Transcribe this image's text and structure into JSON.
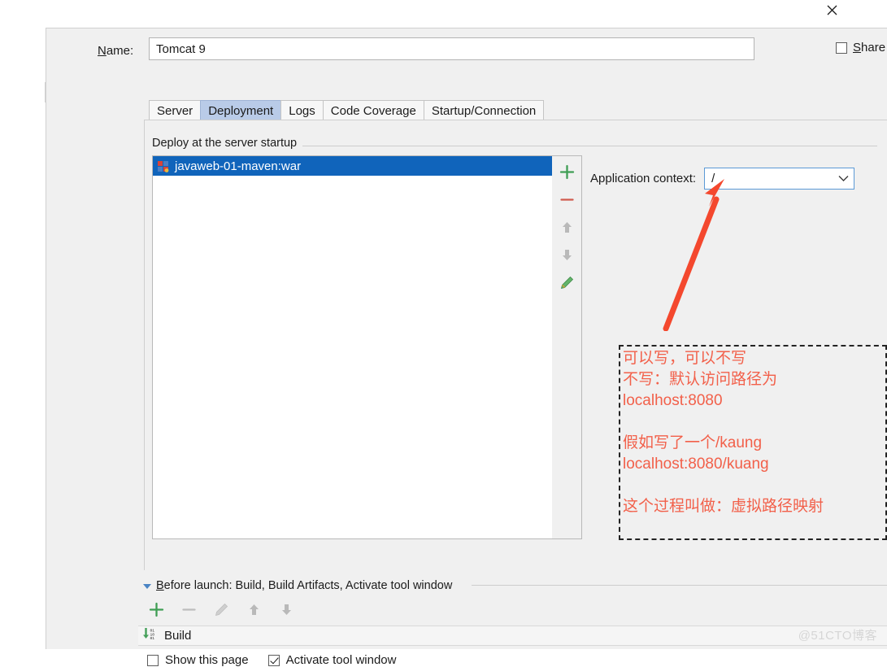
{
  "window": {
    "close_icon": "close-icon"
  },
  "name_row": {
    "label_accel": "N",
    "label_rest": "ame:",
    "value": "Tomcat 9",
    "placeholder": "Name",
    "share_label_accel": "S",
    "share_label_rest": "hare",
    "share_checked": false
  },
  "tabs": [
    {
      "label": "Server",
      "active": false
    },
    {
      "label": "Deployment",
      "active": true
    },
    {
      "label": "Logs",
      "active": false
    },
    {
      "label": "Code Coverage",
      "active": false
    },
    {
      "label": "Startup/Connection",
      "active": false
    }
  ],
  "deployment": {
    "group_title": "Deploy at the server startup",
    "items": [
      {
        "label": "javaweb-01-maven:war",
        "selected": true,
        "icon": "artifact-war-icon"
      }
    ],
    "toolbar": [
      {
        "name": "add-button",
        "icon": "plus-icon",
        "enabled": true
      },
      {
        "name": "remove-button",
        "icon": "minus-icon",
        "enabled": true
      },
      {
        "name": "move-up-button",
        "icon": "arrow-up-icon",
        "enabled": false
      },
      {
        "name": "move-down-button",
        "icon": "arrow-down-icon",
        "enabled": false
      },
      {
        "name": "edit-button",
        "icon": "pencil-icon",
        "enabled": true
      }
    ],
    "application_context": {
      "label": "Application context:",
      "value": "/",
      "dropdown_icon": "chevron-down-icon"
    }
  },
  "annotation": {
    "arrow": "red-arrow-annotation",
    "text": "可以写，可以不写\n不写：默认访问路径为\nlocalhost:8080\n\n假如写了一个/kaung\nlocalhost:8080/kuang\n\n这个过程叫做：虚拟路径映射",
    "color": "#f2604a",
    "box_border_color": "#232323"
  },
  "before_launch": {
    "header_accel": "B",
    "header_rest": "efore launch: Build, Build Artifacts, Activate tool window",
    "collapse_icon": "triangle-down-icon",
    "toolbar": [
      {
        "name": "add-task-button",
        "icon": "plus-icon",
        "enabled": true
      },
      {
        "name": "remove-task-button",
        "icon": "minus-icon",
        "enabled": false
      },
      {
        "name": "edit-task-button",
        "icon": "pencil-icon",
        "enabled": false
      },
      {
        "name": "task-up-button",
        "icon": "arrow-up-icon",
        "enabled": false
      },
      {
        "name": "task-down-button",
        "icon": "arrow-down-icon",
        "enabled": false
      }
    ],
    "tasks": [
      {
        "label": "Build",
        "icon": "build-icon"
      }
    ]
  },
  "bottom_options": {
    "show_this_page_label": "Show this page",
    "show_this_page_checked": false,
    "activate_tool_window_label": "Activate tool window",
    "activate_tool_window_checked": true
  },
  "watermark": {
    "text": "@51CTO博客"
  }
}
